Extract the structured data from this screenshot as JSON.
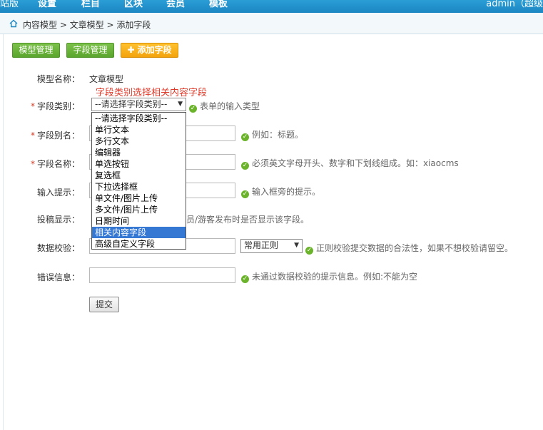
{
  "topnav": {
    "site": "站版",
    "items": [
      "设置",
      "栏目",
      "区块",
      "会员",
      "模板"
    ],
    "user": "admin（超级"
  },
  "breadcrumb": {
    "text": "内容模型 > 文章模型 > 添加字段"
  },
  "toolbar": {
    "model_manage": "模型管理",
    "field_manage": "字段管理",
    "add_field": "添加字段"
  },
  "form": {
    "model_name_label": "模型名称：",
    "model_name_value": "文章模型",
    "annotation": "字段类别选择相关内容字段",
    "field_type_label": "字段类别：",
    "field_type_selected": "--请选择字段类别--",
    "field_type_hint": "表单的输入类型",
    "field_alias_label": "字段别名：",
    "field_alias_hint": "例如：标题。",
    "field_name_label": "字段名称：",
    "field_name_hint": "必须英文字母开头、数字和下划线组成。如：xiaocms",
    "input_tip_label": "输入提示：",
    "input_tip_hint": "输入框旁的提示。",
    "submit_show_label": "投稿显示：",
    "submit_show_hint": "员/游客发布时是否显示该字段。",
    "validation_label": "数据校验：",
    "validation_select": "常用正则",
    "validation_hint": "正则校验提交数据的合法性，如果不想校验请留空。",
    "error_label": "错误信息：",
    "error_hint": "未通过数据校验的提示信息。例如:不能为空",
    "submit_label": "提交"
  },
  "dropdown_options": [
    "--请选择字段类别--",
    "单行文本",
    "多行文本",
    "编辑器",
    "单选按钮",
    "复选框",
    "下拉选择框",
    "单文件/图片上传",
    "多文件/图片上传",
    "日期时间",
    "相关内容字段",
    "高级自定义字段"
  ],
  "dropdown_selected_index": 10,
  "colors": {
    "nav": "#1b86c2",
    "green_button": "#5aa52d",
    "orange_button": "#f3a30c",
    "required": "#d43b24",
    "annotation": "#e03a2a",
    "selection": "#3478d4"
  }
}
